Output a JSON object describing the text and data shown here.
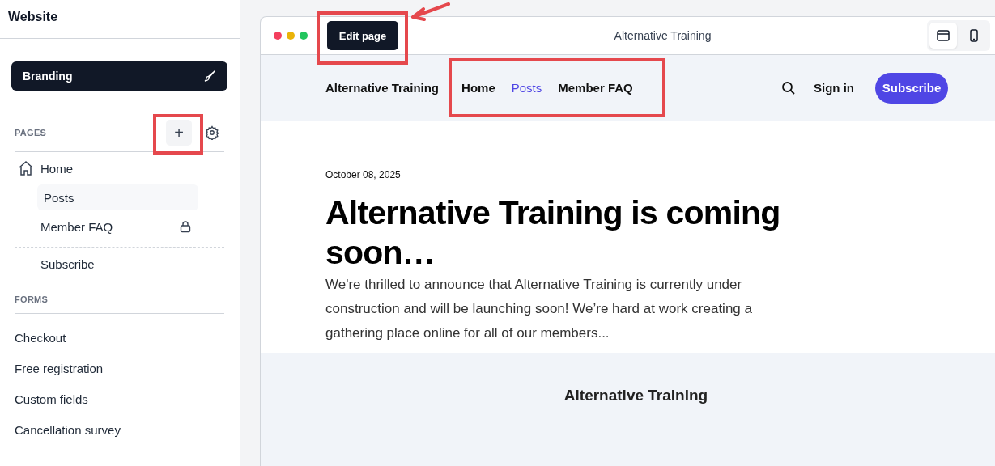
{
  "sidebar": {
    "title": "Website",
    "branding_button": {
      "label": "Branding"
    },
    "pages": {
      "heading": "PAGES",
      "add_button": {
        "label": "+",
        "highlighted": true
      },
      "items": [
        {
          "label": "Home",
          "kind": "home",
          "selected": false,
          "locked": false
        },
        {
          "label": "Posts",
          "kind": "page",
          "selected": true,
          "locked": false
        },
        {
          "label": "Member FAQ",
          "kind": "page",
          "selected": false,
          "locked": true
        }
      ],
      "extra_items": [
        {
          "label": "Subscribe",
          "selected": false
        }
      ]
    },
    "forms": {
      "heading": "FORMS",
      "items": [
        {
          "label": "Checkout"
        },
        {
          "label": "Free registration"
        },
        {
          "label": "Custom fields"
        },
        {
          "label": "Cancellation survey"
        }
      ]
    }
  },
  "preview": {
    "edit_button": {
      "label": "Edit page",
      "highlighted": true,
      "arrow": true
    },
    "title": "Alternative Training",
    "devices": [
      {
        "kind": "desktop",
        "selected": true
      },
      {
        "kind": "mobile",
        "selected": false
      }
    ],
    "site": {
      "brand": "Alternative Training",
      "nav": {
        "highlighted": true,
        "items": [
          {
            "label": "Home",
            "selected": false
          },
          {
            "label": "Posts",
            "selected": true
          },
          {
            "label": "Member FAQ",
            "selected": false
          }
        ]
      },
      "sign_in": "Sign in",
      "subscribe": "Subscribe",
      "post": {
        "date": "October 08, 2025",
        "headline": "Alternative Training is coming soon…",
        "excerpt": "We're thrilled to announce that Alternative Training is currently under construction and will be launching soon! We’re hard at work creating a gathering place online for all of our members..."
      },
      "footer_brand": "Alternative Training"
    }
  }
}
